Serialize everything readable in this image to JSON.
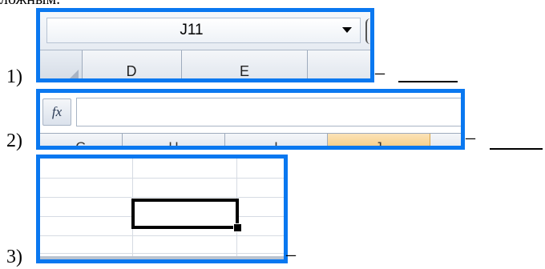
{
  "top_text": "ложным.",
  "items": [
    {
      "number": "1)",
      "dash": "–",
      "namebox": {
        "cell_reference": "J11",
        "column_headers": [
          "D",
          "E",
          ""
        ]
      }
    },
    {
      "number": "2)",
      "dash": "–",
      "formula_bar": {
        "fx_label": "fx",
        "formula_value": "",
        "column_headers": [
          "G",
          "H",
          "I",
          "J",
          ""
        ],
        "highlighted_column_index": 3
      }
    },
    {
      "number": "3)",
      "dash": "–",
      "grid": {
        "description_note": ""
      }
    }
  ],
  "colors": {
    "frame_border": "#0a78f0",
    "highlight_header": "#f6c878"
  }
}
